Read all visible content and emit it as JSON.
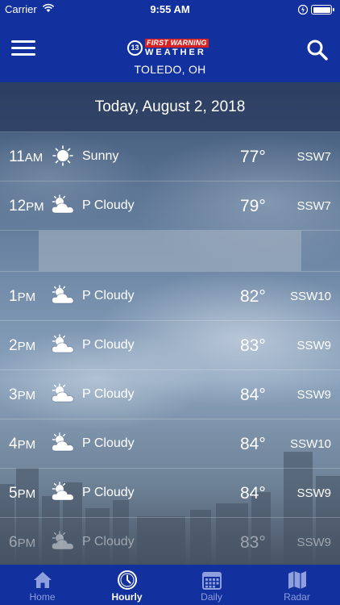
{
  "status_bar": {
    "carrier": "Carrier",
    "time": "9:55 AM"
  },
  "header": {
    "logo_circle": "13",
    "logo_top": "FIRST WARNING",
    "logo_bottom": "WEATHER",
    "location": "TOLEDO, OH"
  },
  "date_label": "Today, August 2, 2018",
  "hours": [
    {
      "hour": "11",
      "ampm": "AM",
      "icon": "sun-icon",
      "condition": "Sunny",
      "temp": "77°",
      "wind": "SSW7"
    },
    {
      "hour": "12",
      "ampm": "PM",
      "icon": "partly-cloudy-icon",
      "condition": "P Cloudy",
      "temp": "79°",
      "wind": "SSW7"
    },
    {
      "hour": "1",
      "ampm": "PM",
      "icon": "partly-cloudy-icon",
      "condition": "P Cloudy",
      "temp": "82°",
      "wind": "SSW10"
    },
    {
      "hour": "2",
      "ampm": "PM",
      "icon": "partly-cloudy-icon",
      "condition": "P Cloudy",
      "temp": "83°",
      "wind": "SSW9"
    },
    {
      "hour": "3",
      "ampm": "PM",
      "icon": "partly-cloudy-icon",
      "condition": "P Cloudy",
      "temp": "84°",
      "wind": "SSW9"
    },
    {
      "hour": "4",
      "ampm": "PM",
      "icon": "partly-cloudy-icon",
      "condition": "P Cloudy",
      "temp": "84°",
      "wind": "SSW10"
    },
    {
      "hour": "5",
      "ampm": "PM",
      "icon": "partly-cloudy-icon",
      "condition": "P Cloudy",
      "temp": "84°",
      "wind": "SSW9"
    },
    {
      "hour": "6",
      "ampm": "PM",
      "icon": "partly-cloudy-icon",
      "condition": "P Cloudy",
      "temp": "83°",
      "wind": "SSW9"
    }
  ],
  "tabs": [
    {
      "label": "Home",
      "icon": "home-icon",
      "active": false
    },
    {
      "label": "Hourly",
      "icon": "clock-icon",
      "active": true
    },
    {
      "label": "Daily",
      "icon": "calendar-icon",
      "active": false
    },
    {
      "label": "Radar",
      "icon": "map-icon",
      "active": false
    }
  ],
  "colors": {
    "header": "#12309e",
    "logo_red": "#d72222",
    "tab_inactive": "#8d9fdc",
    "text": "#ffffff"
  }
}
